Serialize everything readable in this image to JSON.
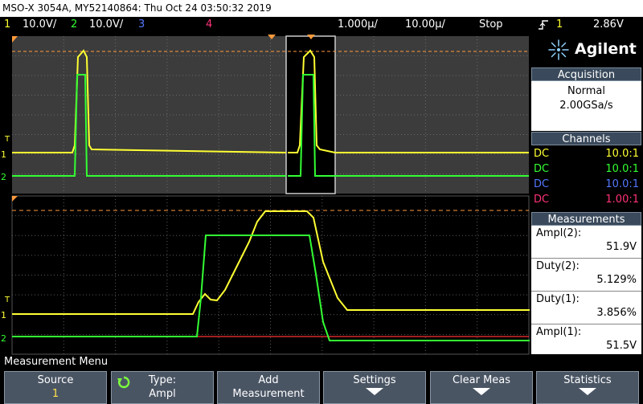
{
  "title": "MSO-X 3054A, MY52140864: Thu Oct 24 03:50:32 2019",
  "status": {
    "ch1_num": "1",
    "ch1_scale": "10.0V/",
    "ch2_num": "2",
    "ch2_scale": "10.0V/",
    "ch3_num": "3",
    "ch4_num": "4",
    "timebase": "1.000µ/",
    "delay": "10.00µ/",
    "run_state": "Stop",
    "trig_icon": "trigger-edge-icon",
    "trig_source": "1",
    "trig_level": "2.86V"
  },
  "brand": {
    "name": "Agilent",
    "logo_icon": "agilent-spark-icon"
  },
  "acquisition": {
    "header": "Acquisition",
    "mode": "Normal",
    "rate": "2.00GSa/s"
  },
  "channels": {
    "header": "Channels",
    "rows": [
      {
        "coupling": "DC",
        "probe": "10.0:1",
        "color": "#ffff33"
      },
      {
        "coupling": "DC",
        "probe": "10.0:1",
        "color": "#33ff33"
      },
      {
        "coupling": "DC",
        "probe": "10.0:1",
        "color": "#5577ff"
      },
      {
        "coupling": "DC",
        "probe": "1.00:1",
        "color": "#ff3377"
      }
    ]
  },
  "measurements": {
    "header": "Measurements",
    "items": [
      {
        "label": "Ampl(2):",
        "value": "51.9V"
      },
      {
        "label": "Duty(2):",
        "value": "5.129%"
      },
      {
        "label": "Duty(1):",
        "value": "3.856%"
      },
      {
        "label": "Ampl(1):",
        "value": "51.5V"
      }
    ]
  },
  "menu": {
    "title": "Measurement Menu",
    "keys": [
      {
        "l1": "Source",
        "l2": "1"
      },
      {
        "l1": "Type:",
        "l2": "Ampl",
        "icon": "rotate-knob-icon"
      },
      {
        "l1": "Add",
        "l2": "Measurement"
      },
      {
        "l1": "Settings",
        "icon": "down-arrow-icon"
      },
      {
        "l1": "Clear Meas",
        "icon": "down-arrow-icon"
      },
      {
        "l1": "Statistics",
        "icon": "down-arrow-icon"
      }
    ]
  },
  "colors": {
    "ch1": "#ffff33",
    "ch2": "#33ff33",
    "ch3": "#5577ff",
    "ch4": "#ff3377",
    "grid_bg": "#3c3c3c"
  },
  "traces": {
    "main_ch1_labels": [
      "1",
      "T"
    ],
    "zoom_ch1_labels": [
      "1",
      "T"
    ],
    "main_ch2_label": "2",
    "zoom_ch2_label": "2"
  }
}
